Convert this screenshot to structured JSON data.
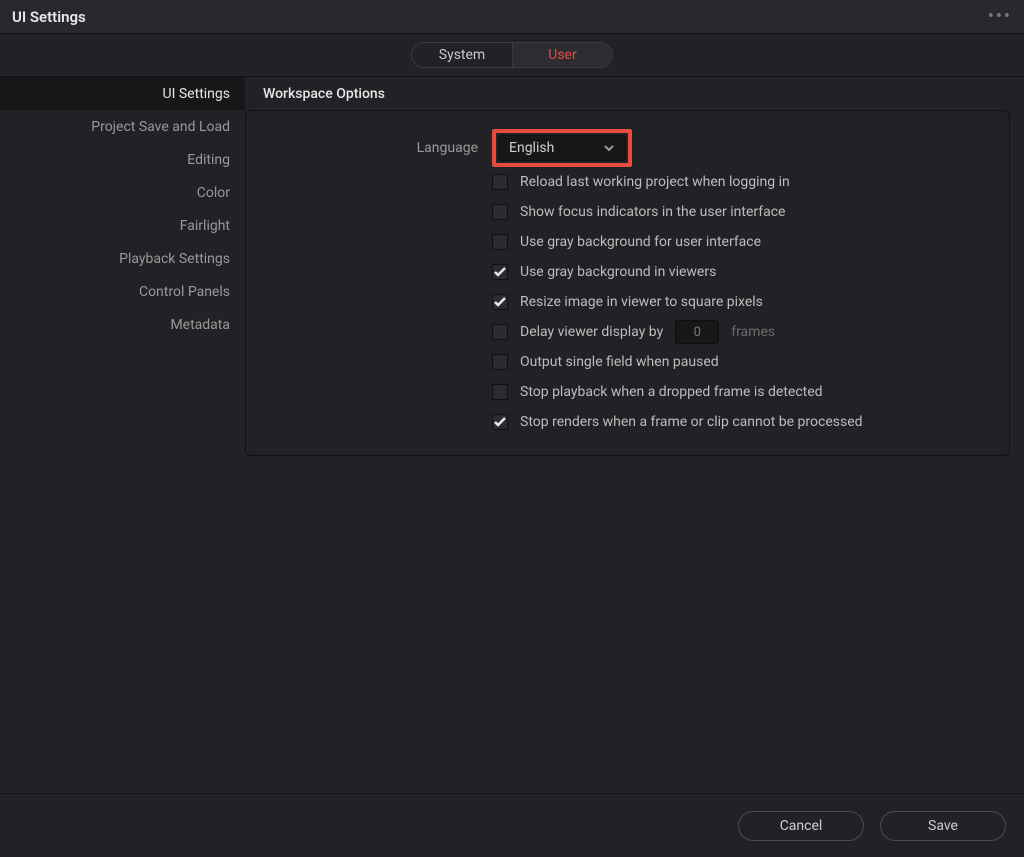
{
  "titlebar": {
    "title": "UI Settings"
  },
  "tabs": {
    "system": "System",
    "user": "User",
    "active": "user"
  },
  "sidebar": {
    "items": [
      {
        "label": "UI Settings",
        "active": true
      },
      {
        "label": "Project Save and Load",
        "active": false
      },
      {
        "label": "Editing",
        "active": false
      },
      {
        "label": "Color",
        "active": false
      },
      {
        "label": "Fairlight",
        "active": false
      },
      {
        "label": "Playback Settings",
        "active": false
      },
      {
        "label": "Control Panels",
        "active": false
      },
      {
        "label": "Metadata",
        "active": false
      }
    ]
  },
  "section": {
    "title": "Workspace Options",
    "language_label": "Language",
    "language_value": "English",
    "options": [
      {
        "label": "Reload last working project when logging in",
        "checked": false
      },
      {
        "label": "Show focus indicators in the user interface",
        "checked": false
      },
      {
        "label": "Use gray background for user interface",
        "checked": false
      },
      {
        "label": "Use gray background in viewers",
        "checked": true
      },
      {
        "label": "Resize image in viewer to square pixels",
        "checked": true
      }
    ],
    "delay": {
      "prefix": "Delay viewer display by",
      "value": "0",
      "unit": "frames",
      "checked": false
    },
    "options2": [
      {
        "label": "Output single field when paused",
        "checked": false
      },
      {
        "label": "Stop playback when a dropped frame is detected",
        "checked": false
      },
      {
        "label": "Stop renders when a frame or clip cannot be processed",
        "checked": true
      }
    ]
  },
  "footer": {
    "cancel": "Cancel",
    "save": "Save"
  }
}
